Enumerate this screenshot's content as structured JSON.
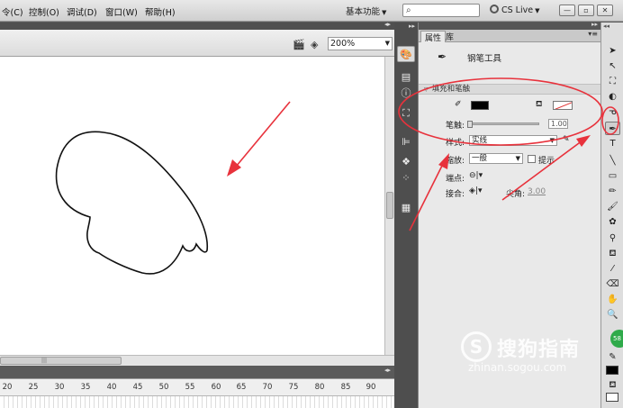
{
  "menubar": {
    "items": [
      "令(C)",
      "控制(O)",
      "调试(D)",
      "窗口(W)",
      "帮助(H)"
    ],
    "workspace": "基本功能",
    "search_placeholder": "",
    "cslive": "CS Live"
  },
  "edit_bar": {
    "zoom": "200%"
  },
  "timeline": {
    "ticks": [
      "20",
      "25",
      "30",
      "35",
      "40",
      "45",
      "50",
      "55",
      "60",
      "65",
      "70",
      "75",
      "80",
      "85",
      "90"
    ],
    "scroll_grip": "|||"
  },
  "properties": {
    "tabs": [
      "属性",
      "库"
    ],
    "tool_name": "钢笔工具",
    "section": "填充和笔触",
    "stroke_label": "笔触:",
    "stroke_value": "1.00",
    "style_label": "样式:",
    "style_value": "实线",
    "scale_label": "缩放:",
    "scale_value": "一般",
    "hint_label": "提示",
    "cap_label": "端点:",
    "join_label": "接合:",
    "miter_label": "尖角:",
    "miter_value": "3.00"
  },
  "colors": {
    "stroke_color": "#000000",
    "annotation_red": "#e8323c"
  },
  "watermark": {
    "logo": "S",
    "text": "搜狗指南",
    "url": "zhinan.sogou.com",
    "badge": "58"
  }
}
